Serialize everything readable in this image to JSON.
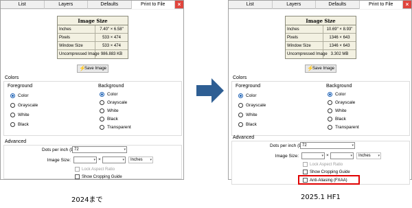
{
  "tabs": [
    "List",
    "Layers",
    "Defaults",
    "Print to File"
  ],
  "close_glyph": "×",
  "image_size": {
    "title": "Image Size",
    "labels": [
      "Inches",
      "Pixels",
      "Window Size",
      "Uncompressed Image"
    ]
  },
  "left": {
    "values": [
      "7.40\" × 6.58\"",
      "533 × 474",
      "533 × 474",
      "986.883 KB"
    ]
  },
  "right": {
    "values": [
      "10.69\" × 8.93\"",
      "1346 × 643",
      "1346 × 643",
      "3.302 MB"
    ]
  },
  "save_button": "Save Image",
  "colors": {
    "label": "Colors",
    "foreground": "Foreground",
    "background": "Background",
    "fg_options": [
      "Color",
      "Grayscale",
      "White",
      "Black"
    ],
    "bg_options": [
      "Color",
      "Grayscale",
      "White",
      "Black",
      "Transparent"
    ]
  },
  "advanced": {
    "label": "Advanced",
    "dpi_label": "Dots per inch (DPI):",
    "dpi_value": "72",
    "image_size_label": "Image Size:",
    "times": "×",
    "units": "Inches",
    "lock_aspect": "Lock Aspect Ratio",
    "show_crop": "Show Cropping Guide",
    "anti_alias": "Anti-Aliasing (FXAA)"
  },
  "captions": {
    "left": "2024まで",
    "right": "2025.1 HF1"
  },
  "accent": "#1a5fb4",
  "highlight_color": "#e00000"
}
